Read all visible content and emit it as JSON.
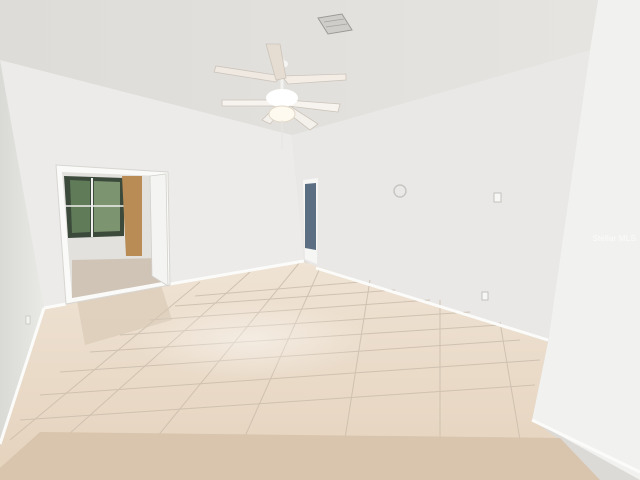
{
  "scene": {
    "subject": "vacant-room-interior",
    "colors": {
      "ceiling": "#e4e2df",
      "wall_back": "#eeeeec",
      "wall_left": "#e2e2df",
      "wall_right_far": "#e7e7e5",
      "wall_right_near": "#f1f1ef",
      "floor_tile": "#e8d9c7",
      "grout": "#c9bba8",
      "carpet": "#d8c3ac",
      "curtain": "#b98b55",
      "baseboard": "#fbfbfa"
    },
    "objects": [
      "ceiling-fan-icon",
      "air-vent-icon",
      "wall-clock-icon",
      "light-switch-icon",
      "power-outlet-icon"
    ]
  },
  "watermark": {
    "text": "Stellar MLS"
  }
}
